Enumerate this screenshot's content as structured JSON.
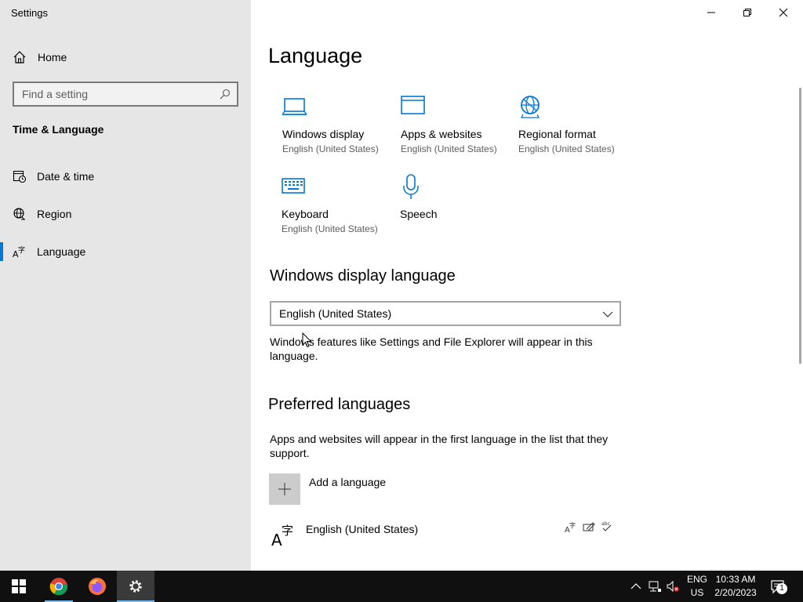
{
  "window": {
    "title": "Settings"
  },
  "sidebar": {
    "home_label": "Home",
    "search_placeholder": "Find a setting",
    "section": "Time & Language",
    "items": [
      {
        "label": "Date & time",
        "icon": "calendar-clock-icon"
      },
      {
        "label": "Region",
        "icon": "globe-icon"
      },
      {
        "label": "Language",
        "icon": "language-icon",
        "active": true
      }
    ]
  },
  "main": {
    "title": "Language",
    "tiles": [
      {
        "name": "Windows display",
        "sub": "English (United States)",
        "icon": "laptop-icon"
      },
      {
        "name": "Apps & websites",
        "sub": "English (United States)",
        "icon": "browser-window-icon"
      },
      {
        "name": "Regional format",
        "sub": "English (United States)",
        "icon": "globe-settings-icon"
      },
      {
        "name": "Keyboard",
        "sub": "English (United States)",
        "icon": "keyboard-icon"
      },
      {
        "name": "Speech",
        "sub": "",
        "icon": "microphone-icon"
      }
    ],
    "display_language": {
      "heading": "Windows display language",
      "selected": "English (United States)",
      "description": "Windows features like Settings and File Explorer will appear in this language."
    },
    "preferred": {
      "heading": "Preferred languages",
      "description": "Apps and websites will appear in the first language in the list that they support.",
      "add_label": "Add a language",
      "languages": [
        {
          "name": "English (United States)",
          "features": [
            "display-language-icon",
            "handwriting-icon",
            "spellcheck-icon"
          ]
        }
      ]
    }
  },
  "taskbar": {
    "apps": [
      "start-icon",
      "chrome-icon",
      "firefox-icon",
      "settings-icon"
    ],
    "lang_line1": "ENG",
    "lang_line2": "US",
    "time": "10:33 AM",
    "date": "2/20/2023",
    "notification_count": "1"
  },
  "colors": {
    "accent": "#0078d7",
    "sidebar_bg": "#e6e6e6",
    "taskbar_bg": "#101010"
  }
}
